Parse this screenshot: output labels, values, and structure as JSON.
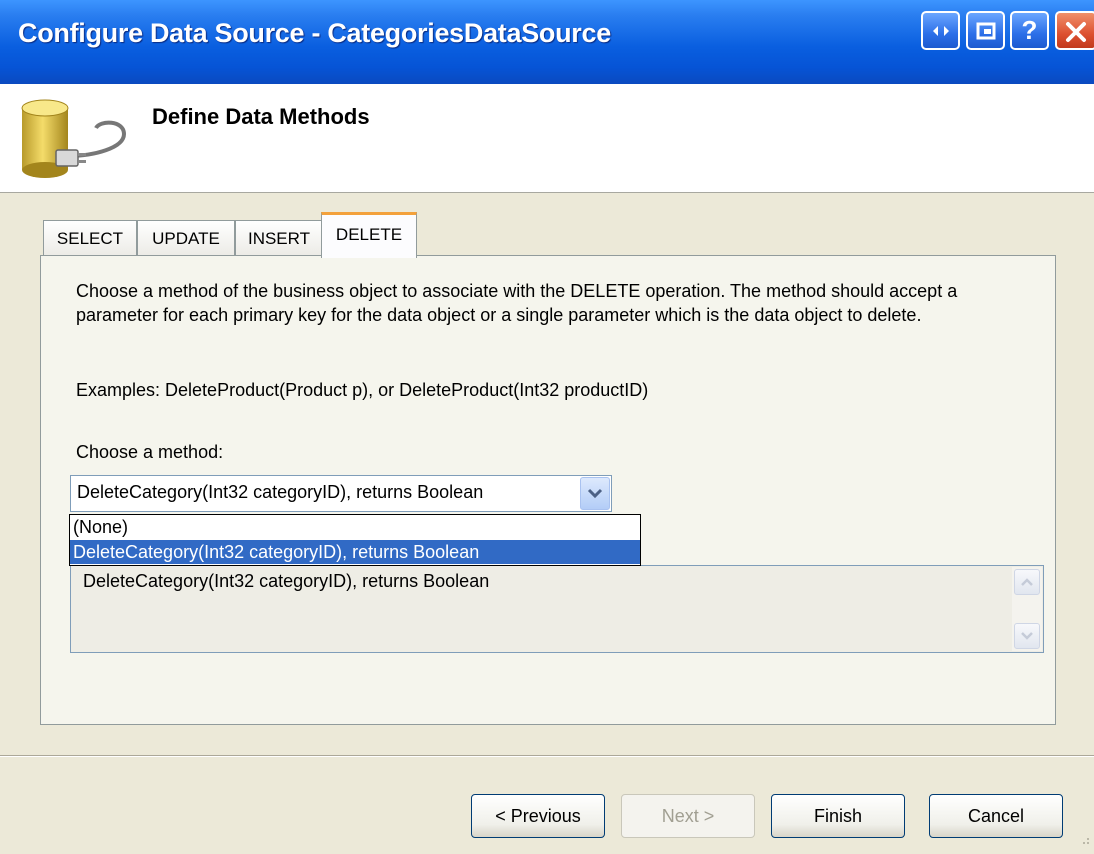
{
  "window": {
    "title": "Configure Data Source - CategoriesDataSource",
    "controls": [
      "help-icon",
      "close-icon"
    ]
  },
  "header": {
    "title": "Define Data Methods",
    "icon": "database-plug-icon"
  },
  "tabs": [
    {
      "label": "SELECT",
      "active": false
    },
    {
      "label": "UPDATE",
      "active": false
    },
    {
      "label": "INSERT",
      "active": false
    },
    {
      "label": "DELETE",
      "active": true
    }
  ],
  "content": {
    "description": "Choose a method of the business object to associate with the DELETE operation. The method should accept a parameter for each primary key for the data object or a single parameter which is the data object to delete.",
    "examples": "Examples: DeleteProduct(Product p), or DeleteProduct(Int32 productID)",
    "choose_label": "Choose a method:",
    "method_selected": "DeleteCategory(Int32 categoryID), returns Boolean",
    "method_options": [
      "(None)",
      "DeleteCategory(Int32 categoryID), returns Boolean"
    ],
    "method_signature": "DeleteCategory(Int32 categoryID), returns Boolean"
  },
  "buttons": {
    "previous": "< Previous",
    "next": "Next >",
    "finish": "Finish",
    "cancel": "Cancel"
  },
  "colors": {
    "title_bar": "#0a5fe0",
    "selection": "#316ac5",
    "tab_highlight": "#f3a13b"
  }
}
